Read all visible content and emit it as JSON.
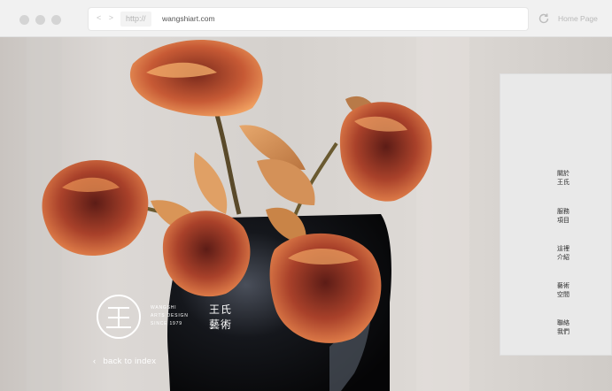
{
  "browser": {
    "nav_arrows": "< >",
    "protocol": "http://",
    "domain": "wangshiart.com",
    "home_label": "Home Page"
  },
  "logo": {
    "mark_char": "王",
    "en_lines": [
      "WANGSHI",
      "ARTS DESIGN",
      "SINCE 1979"
    ],
    "cn_lines": [
      "王氏",
      "藝術"
    ]
  },
  "back_link": {
    "label": "back to index"
  },
  "menu": [
    {
      "lines": [
        "關於",
        "王氏"
      ]
    },
    {
      "lines": [
        "服務",
        "項目"
      ]
    },
    {
      "lines": [
        "這裡",
        "介紹"
      ]
    },
    {
      "lines": [
        "藝術",
        "空間"
      ]
    },
    {
      "lines": [
        "聯絡",
        "我們"
      ]
    }
  ],
  "icons": {
    "reload": "reload-icon",
    "back": "chevron-left-icon",
    "logo": "wangshi-logo-icon"
  }
}
